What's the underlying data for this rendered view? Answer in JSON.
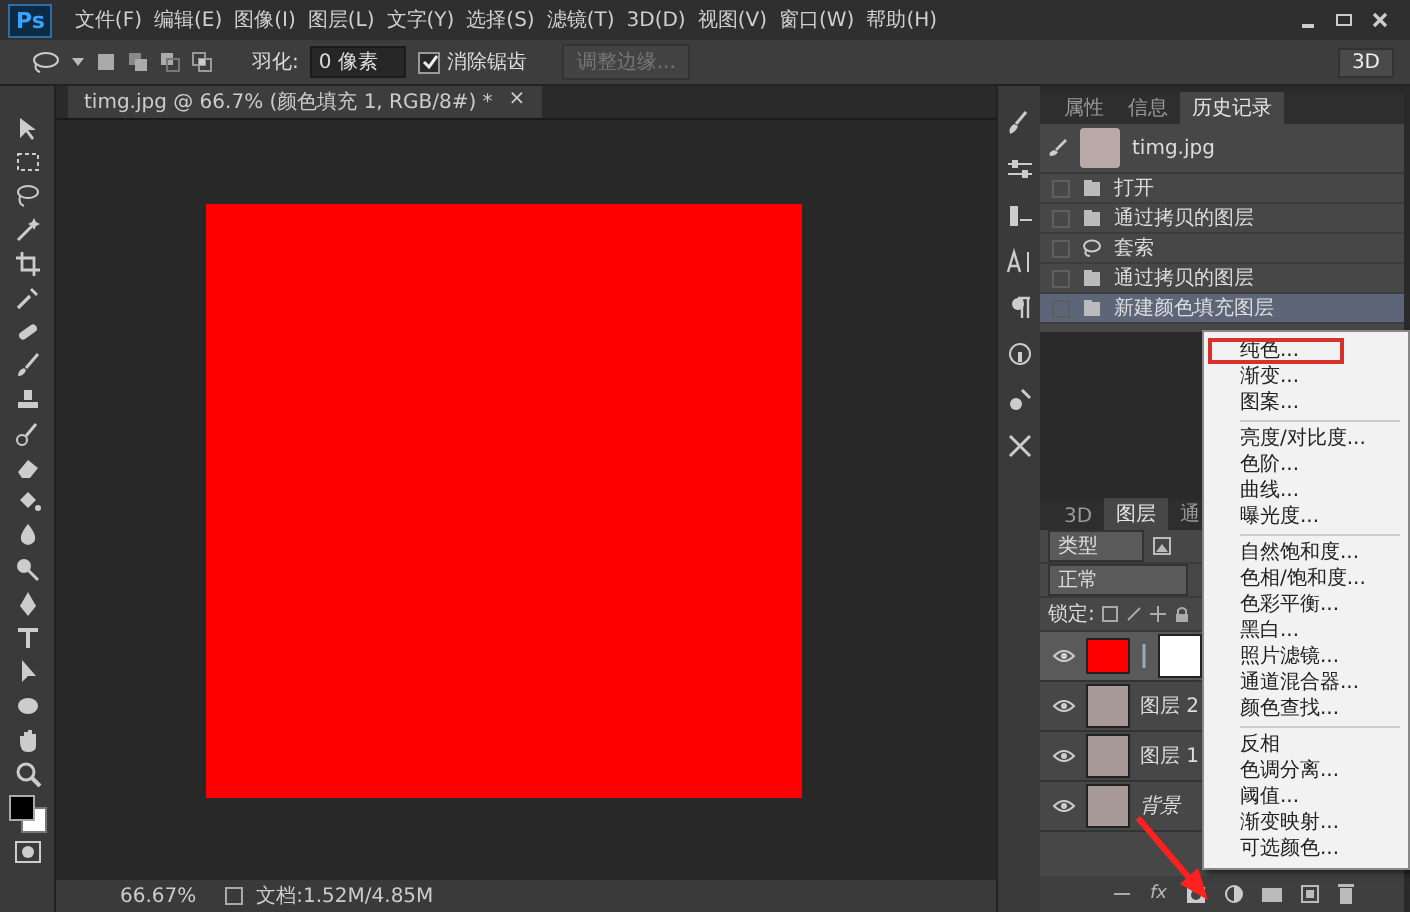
{
  "app": {
    "logo": "Ps"
  },
  "menu": [
    {
      "label": "文件(F)"
    },
    {
      "label": "编辑(E)"
    },
    {
      "label": "图像(I)"
    },
    {
      "label": "图层(L)"
    },
    {
      "label": "文字(Y)"
    },
    {
      "label": "选择(S)"
    },
    {
      "label": "滤镜(T)"
    },
    {
      "label": "3D(D)"
    },
    {
      "label": "视图(V)"
    },
    {
      "label": "窗口(W)"
    },
    {
      "label": "帮助(H)"
    }
  ],
  "options_bar": {
    "feather_label": "羽化:",
    "feather_value": "0 像素",
    "anti_alias": {
      "label": "消除锯齿",
      "checked": true
    },
    "refine_edge": {
      "label": "调整边缘...",
      "disabled": true
    },
    "workspace_button": "3D"
  },
  "document": {
    "tab_title": "timg.jpg @ 66.7% (颜色填充 1, RGB/8#) *",
    "tab_close": "×"
  },
  "history_panel": {
    "tabs": [
      {
        "label": "属性",
        "selected": false
      },
      {
        "label": "信息",
        "selected": false
      },
      {
        "label": "历史记录",
        "selected": true
      }
    ],
    "snapshot": "timg.jpg",
    "items": [
      {
        "kind": "layer",
        "label": "打开",
        "selected": false
      },
      {
        "kind": "layer",
        "label": "通过拷贝的图层",
        "selected": false
      },
      {
        "kind": "lasso",
        "label": "套索",
        "selected": false
      },
      {
        "kind": "layer",
        "label": "通过拷贝的图层",
        "selected": false
      },
      {
        "kind": "layer",
        "label": "新建颜色填充图层",
        "selected": true
      }
    ]
  },
  "layers_panel": {
    "tabs": [
      {
        "label": "3D",
        "selected": false
      },
      {
        "label": "图层",
        "selected": true
      },
      {
        "label": "通",
        "selected": false
      }
    ],
    "filter": "类型",
    "blend_mode": "正常",
    "lock_label": "锁定:",
    "layers": [
      {
        "kind": "fill",
        "selected": true
      },
      {
        "kind": "image",
        "name": "图层 2",
        "selected": false
      },
      {
        "kind": "image",
        "name": "图层 1",
        "selected": false
      },
      {
        "kind": "background",
        "name": "背景",
        "selected": false
      }
    ],
    "fx_label": "fx"
  },
  "adjustment_menu": {
    "groups": [
      [
        {
          "label": "纯色...",
          "highlighted": true
        },
        {
          "label": "渐变...",
          "highlighted": false
        },
        {
          "label": "图案...",
          "highlighted": false
        }
      ],
      [
        {
          "label": "亮度/对比度...",
          "highlighted": false
        },
        {
          "label": "色阶...",
          "highlighted": false
        },
        {
          "label": "曲线...",
          "highlighted": false
        },
        {
          "label": "曝光度...",
          "highlighted": false
        }
      ],
      [
        {
          "label": "自然饱和度...",
          "highlighted": false
        },
        {
          "label": "色相/饱和度...",
          "highlighted": false
        },
        {
          "label": "色彩平衡...",
          "highlighted": false
        },
        {
          "label": "黑白...",
          "highlighted": false
        },
        {
          "label": "照片滤镜...",
          "highlighted": false
        },
        {
          "label": "通道混合器...",
          "highlighted": false
        },
        {
          "label": "颜色查找...",
          "highlighted": false
        }
      ],
      [
        {
          "label": "反相",
          "highlighted": false
        },
        {
          "label": "色调分离...",
          "highlighted": false
        },
        {
          "label": "阈值...",
          "highlighted": false
        },
        {
          "label": "渐变映射...",
          "highlighted": false
        },
        {
          "label": "可选颜色...",
          "highlighted": false
        }
      ]
    ]
  },
  "status_bar": {
    "zoom": "66.67%",
    "doc_size": "文档:1.52M/4.85M"
  }
}
